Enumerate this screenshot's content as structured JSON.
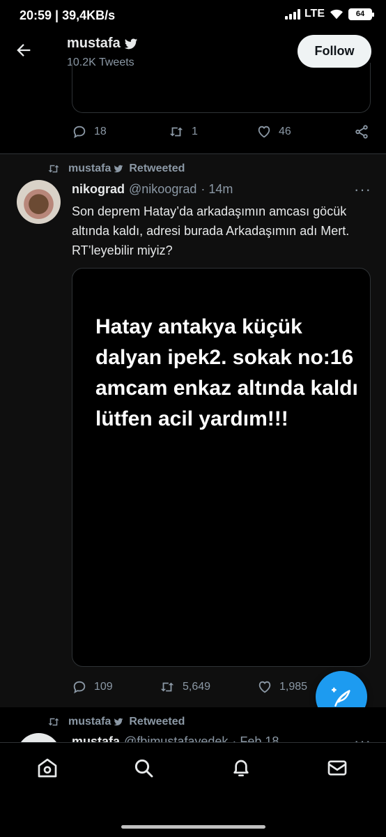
{
  "status_bar": {
    "time": "20:59 | 39,4KB/s",
    "network": "LTE",
    "battery": "64"
  },
  "header": {
    "name": "mustafa",
    "tweet_count": "10.2K Tweets",
    "follow_label": "Follow"
  },
  "tweet1": {
    "replies": "18",
    "retweets": "1",
    "likes": "46"
  },
  "tweet2": {
    "retweeted_by": "mustafa",
    "retweeted_label": "Retweeted",
    "author_name": "nikograd",
    "author_handle": "@nikoograd",
    "time": "· 14m",
    "text": "Son deprem Hatay’da arkadaşımın amcası göcük altında kaldı, adresi burada Arkadaşımın adı Mert. RT’leyebilir miyiz?",
    "image_text": "Hatay antakya küçük dalyan ipek2. sokak no:16 amcam enkaz altında kaldı lütfen acil yardım!!!",
    "replies": "109",
    "retweets": "5,649",
    "likes": "1,985"
  },
  "tweet3": {
    "retweeted_by": "mustafa",
    "retweeted_label": "Retweeted",
    "author_name": "mustafa",
    "author_handle": "@fbimustafayedek",
    "time": "· Feb 18"
  },
  "colors": {
    "accent": "#1d9bf0",
    "text_primary": "#e7e9ea",
    "text_secondary": "#8b98a5",
    "background": "#000000"
  }
}
